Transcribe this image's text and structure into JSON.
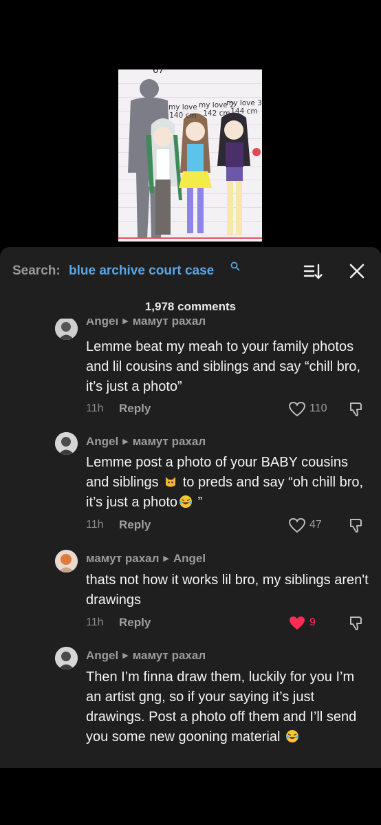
{
  "video": {
    "top_number": "67",
    "labels": [
      {
        "name": "my love",
        "height": "140 cm"
      },
      {
        "name": "my love 2",
        "height": "142 cm"
      },
      {
        "name": "my love 3",
        "height": "144 cm"
      }
    ]
  },
  "search": {
    "prefix": "Search:",
    "query": "blue archive court case"
  },
  "comments_count": "1,978 comments",
  "comments": [
    {
      "user": "Angel",
      "reply_to": "мамут рахал",
      "text": "Lemme beat my meah to your family photos and lil cousins and siblings and say “chill bro, it’s just a photo”",
      "time": "11h",
      "reply_label": "Reply",
      "likes": "110",
      "liked": false
    },
    {
      "user": "Angel",
      "reply_to": "мамут рахал",
      "text_parts": [
        "Lemme post a photo of your BABY cousins and siblings ",
        " to preds and say “oh chill bro, it’s just a photo",
        " ”"
      ],
      "emojis": [
        "cat-emoji",
        "laughing-emoji"
      ],
      "time": "11h",
      "reply_label": "Reply",
      "likes": "47",
      "liked": false
    },
    {
      "user": "мамут рахал",
      "reply_to": "Angel",
      "text": "thats not how it works lil bro, my siblings aren't drawings",
      "time": "11h",
      "reply_label": "Reply",
      "likes": "9",
      "liked": true
    },
    {
      "user": "Angel",
      "reply_to": "мамут рахал",
      "text": "Then I’m finna draw them, luckily for you I’m an artist gng, so if your saying it’s just drawings. Post a photo off them and I’ll send you some new gooning material ",
      "emojis": [
        "laughing-emoji"
      ]
    }
  ],
  "colors": {
    "sheet_bg": "#1f1f1f",
    "search_query": "#5ba6e6",
    "liked_heart": "#fe2c55"
  }
}
